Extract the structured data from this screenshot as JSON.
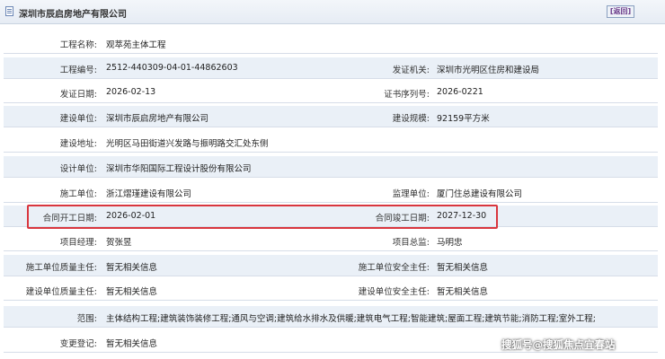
{
  "header": {
    "title": "深圳市辰启房地产有限公司",
    "back": "[返回]"
  },
  "rows": [
    {
      "l1": "工程名称:",
      "v1": "观萃苑主体工程",
      "l2": "",
      "v2": ""
    },
    {
      "l1": "工程编号:",
      "v1": "2512-440309-04-01-44862603",
      "l2": "发证机关:",
      "v2": "深圳市光明区住房和建设局"
    },
    {
      "l1": "发证日期:",
      "v1": "2026-02-13",
      "l2": "证书序列号:",
      "v2": "2026-0221"
    },
    {
      "l1": "建设单位:",
      "v1": "深圳市辰启房地产有限公司",
      "l2": "建设规模:",
      "v2": "92159平方米"
    },
    {
      "l1": "建设地址:",
      "v1": "光明区马田街道兴发路与振明路交汇处东侧",
      "l2": "",
      "v2": ""
    },
    {
      "l1": "设计单位:",
      "v1": "深圳市华阳国际工程设计股份有限公司",
      "l2": "",
      "v2": ""
    },
    {
      "l1": "施工单位:",
      "v1": "浙江熠瑾建设有限公司",
      "l2": "监理单位:",
      "v2": "厦门住总建设有限公司"
    },
    {
      "l1": "合同开工日期:",
      "v1": "2026-02-01",
      "l2": "合同竣工日期:",
      "v2": "2027-12-30"
    },
    {
      "l1": "项目经理:",
      "v1": "贺张昱",
      "l2": "项目总监:",
      "v2": "马明忠"
    },
    {
      "l1": "施工单位质量主任:",
      "v1": "暂无相关信息",
      "l2": "施工单位安全主任:",
      "v2": "暂无相关信息"
    },
    {
      "l1": "建设单位质量主任:",
      "v1": "暂无相关信息",
      "l2": "建设单位安全主任:",
      "v2": "暂无相关信息"
    },
    {
      "l1": "范围:",
      "v1": "主体结构工程;建筑装饰装修工程;通风与空调;建筑给水排水及供暖;建筑电气工程;智能建筑;屋面工程;建筑节能;消防工程;室外工程;",
      "l2": "",
      "v2": ""
    },
    {
      "l1": "变更登记:",
      "v1": "暂无相关信息",
      "l2": "",
      "v2": ""
    }
  ],
  "watermark": "搜狐号@搜狐焦点宜春站"
}
